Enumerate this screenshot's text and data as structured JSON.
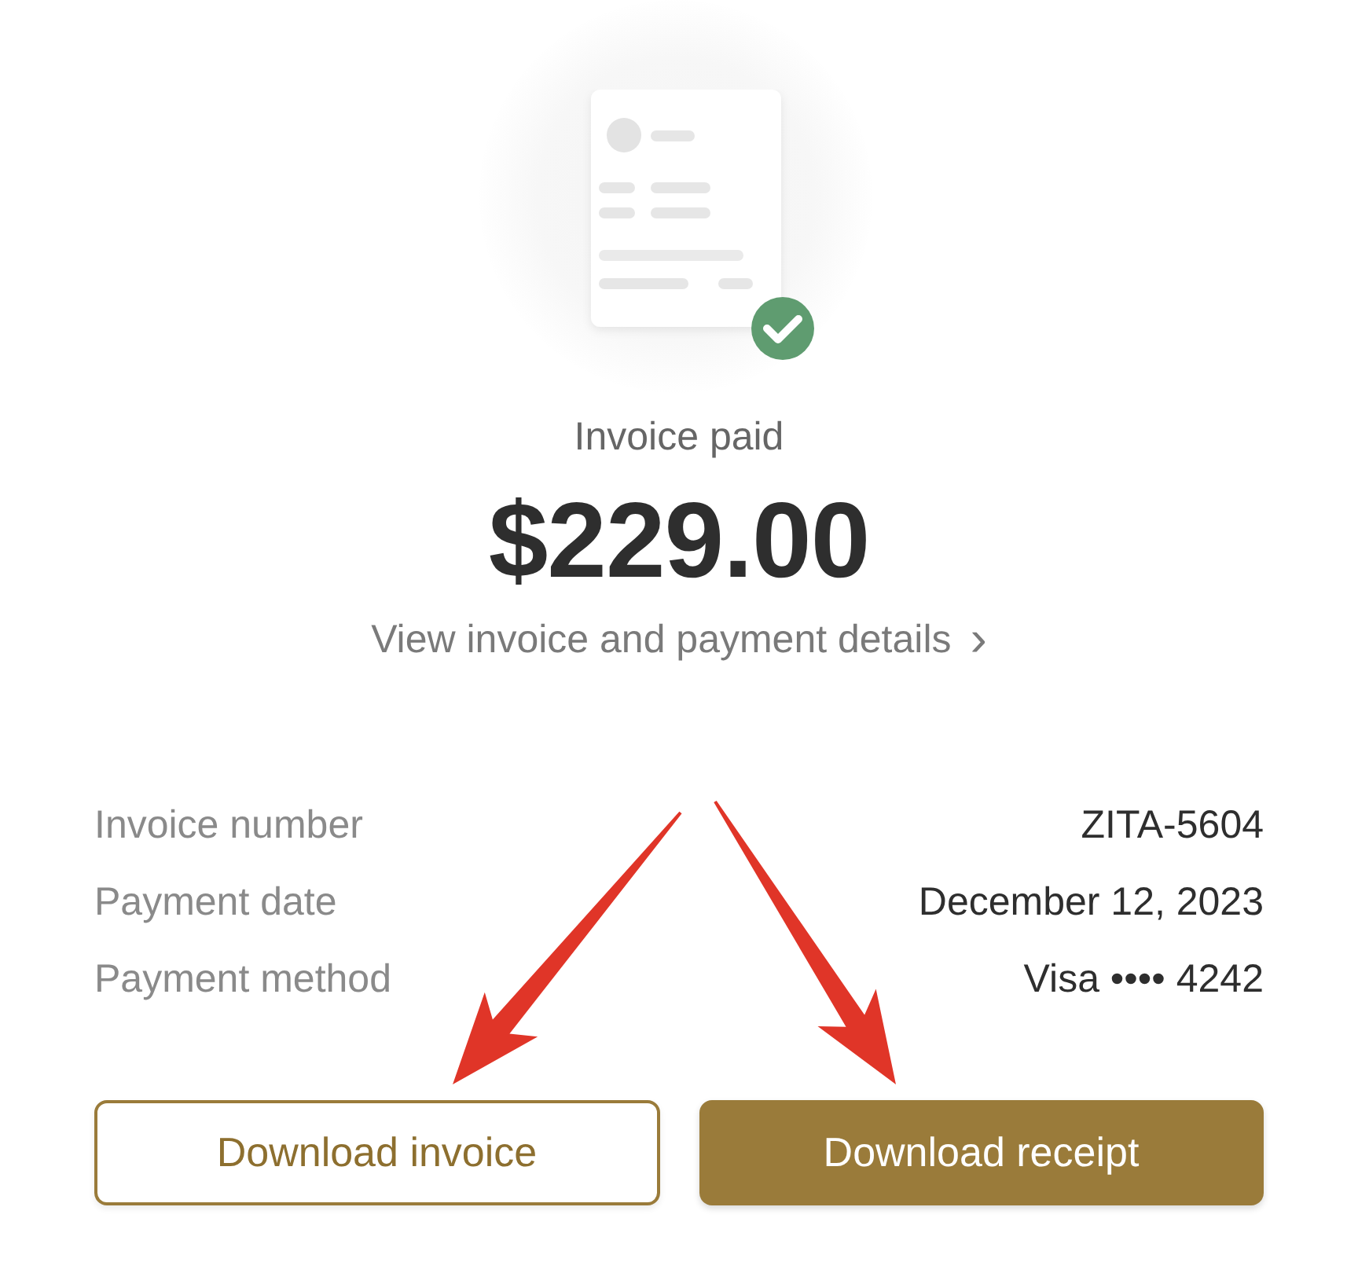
{
  "status": {
    "label": "Invoice paid",
    "paid": true
  },
  "amount": "$229.00",
  "details_link": {
    "label": "View invoice and payment details",
    "chevron": "›"
  },
  "details": [
    {
      "label": "Invoice number",
      "value": "ZITA-5604"
    },
    {
      "label": "Payment date",
      "value": "December 12, 2023"
    },
    {
      "label": "Payment method",
      "value": "Visa •••• 4242"
    }
  ],
  "buttons": [
    {
      "label": "Download invoice",
      "kind": "outline"
    },
    {
      "label": "Download receipt",
      "kind": "filled"
    }
  ]
}
